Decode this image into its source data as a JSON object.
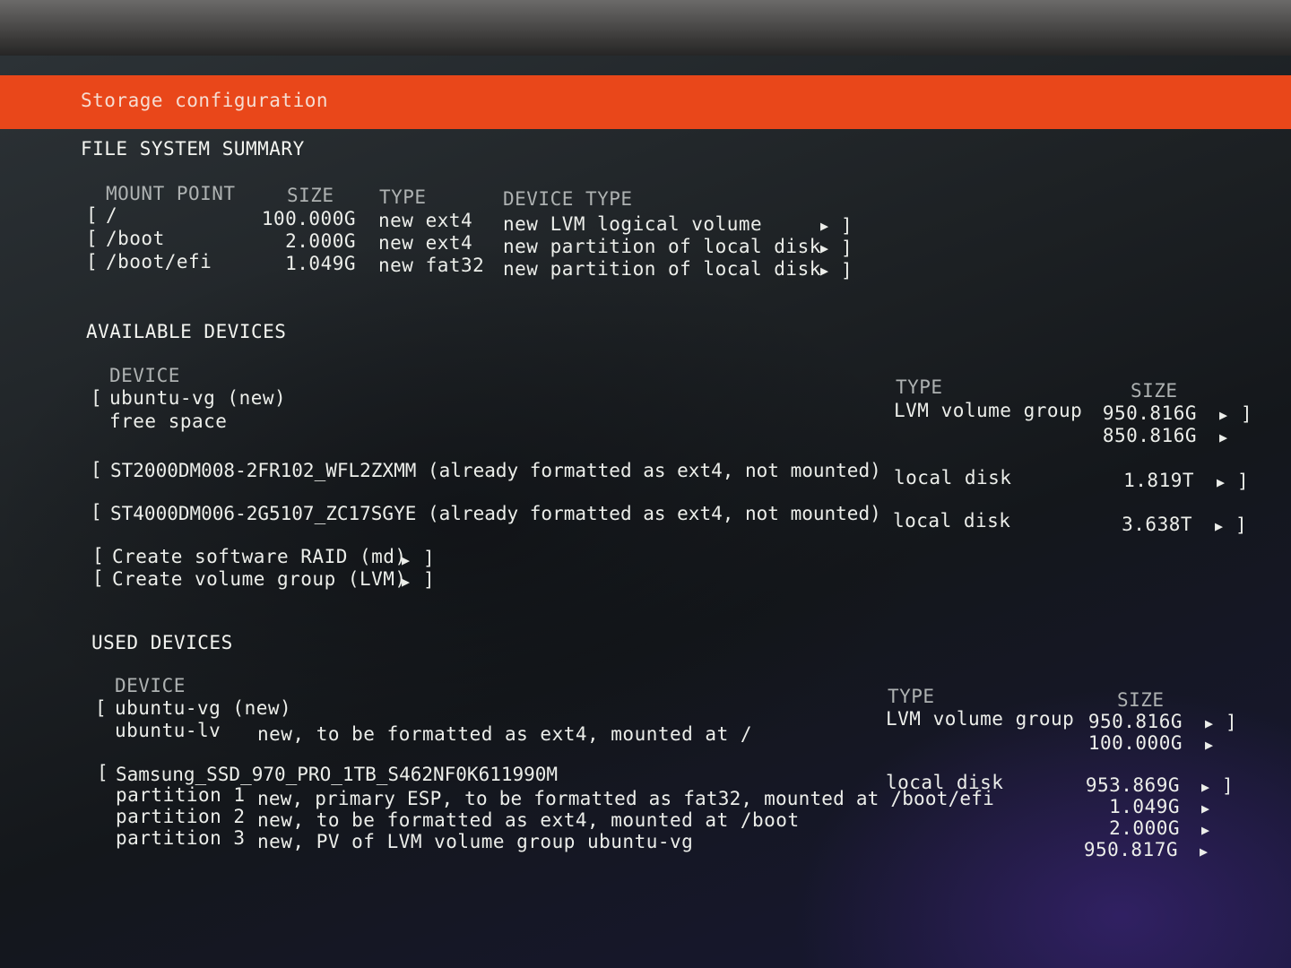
{
  "header": {
    "title": "Storage configuration"
  },
  "fs_summary": {
    "heading": "FILE SYSTEM SUMMARY",
    "col_mount": "MOUNT POINT",
    "col_size": "SIZE",
    "col_type": "TYPE",
    "col_device_type": "DEVICE TYPE",
    "rows": [
      {
        "mount": "/",
        "size": "100.000G",
        "type": "new ext4",
        "device_type": "new LVM logical volume"
      },
      {
        "mount": "/boot",
        "size": "2.000G",
        "type": "new ext4",
        "device_type": "new partition of local disk"
      },
      {
        "mount": "/boot/efi",
        "size": "1.049G",
        "type": "new fat32",
        "device_type": "new partition of local disk"
      }
    ]
  },
  "available": {
    "heading": "AVAILABLE DEVICES",
    "col_device": "DEVICE",
    "col_type": "TYPE",
    "col_size": "SIZE",
    "vg": {
      "name": "ubuntu-vg (new)",
      "type": "LVM volume group",
      "size": "950.816G",
      "free_label": "free space",
      "free_size": "850.816G"
    },
    "disk1": {
      "name": "ST2000DM008-2FR102_WFL2ZXMM (already formatted as ext4, not mounted)",
      "type": "local disk",
      "size": "1.819T"
    },
    "disk2": {
      "name": "ST4000DM006-2G5107_ZC17SGYE (already formatted as ext4, not mounted)",
      "type": "local disk",
      "size": "3.638T"
    },
    "create_raid": "Create software RAID (md)",
    "create_lvm": "Create volume group (LVM)"
  },
  "used": {
    "heading": "USED DEVICES",
    "col_device": "DEVICE",
    "col_type": "TYPE",
    "col_size": "SIZE",
    "vg": {
      "name": "ubuntu-vg (new)",
      "type": "LVM volume group",
      "size": "950.816G",
      "lv_name": "ubuntu-lv",
      "lv_desc": "new, to be formatted as ext4, mounted at /",
      "lv_size": "100.000G"
    },
    "ssd": {
      "name": "Samsung_SSD_970_PRO_1TB_S462NF0K611990M",
      "type": "local disk",
      "size": "953.869G",
      "partitions": [
        {
          "label": "partition 1",
          "desc": "new, primary ESP, to be formatted as fat32, mounted at /boot/efi",
          "size": "1.049G"
        },
        {
          "label": "partition 2",
          "desc": "new, to be formatted as ext4, mounted at /boot",
          "size": "2.000G"
        },
        {
          "label": "partition 3",
          "desc": "new, PV of LVM volume group ubuntu-vg",
          "size": "950.817G"
        }
      ]
    }
  },
  "glyphs": {
    "open_bracket": "[",
    "close_bracket": "]",
    "arrow": "▶"
  },
  "colors": {
    "header_bg": "#e9471a",
    "text": "#eceeea",
    "screen_bg": "#1d2124"
  }
}
